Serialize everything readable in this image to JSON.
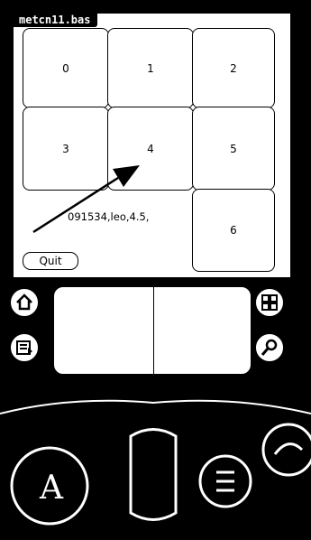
{
  "app": {
    "title": "metcn11.bas"
  },
  "keypad": {
    "keys": [
      {
        "label": "0"
      },
      {
        "label": "1"
      },
      {
        "label": "2"
      },
      {
        "label": "3"
      },
      {
        "label": "4"
      },
      {
        "label": "5"
      },
      {
        "label": "6"
      }
    ]
  },
  "record_line": "091534,leo,4.5,",
  "quit_label": "Quit",
  "silkscreen": {
    "icons": [
      "home-icon",
      "applications-icon",
      "menu-icon",
      "find-icon"
    ]
  },
  "hardware": {
    "icons": [
      "date-book-icon",
      "scroll-icon",
      "todo-icon",
      "memo-icon"
    ]
  }
}
